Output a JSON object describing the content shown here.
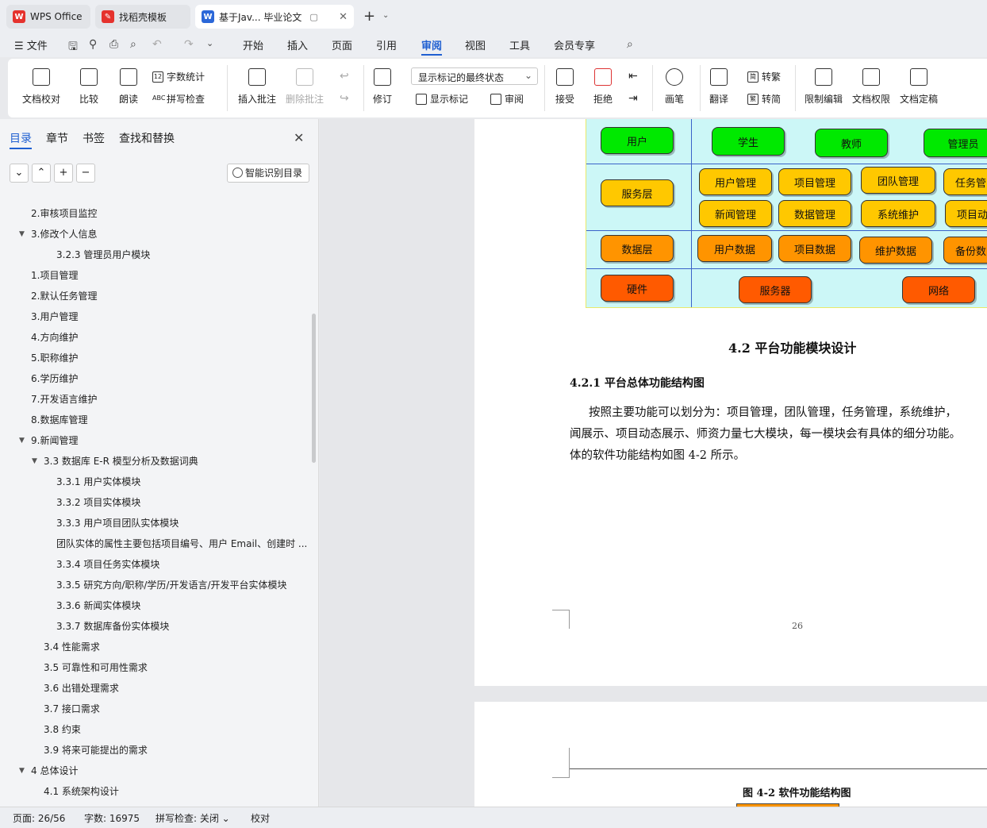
{
  "tabs": [
    {
      "label": "WPS Office",
      "icon": "wps-logo-icon"
    },
    {
      "label": "找稻壳模板",
      "icon": "docer-icon"
    },
    {
      "label": "基于Jav... 毕业论文",
      "icon": "writer-doc-icon"
    }
  ],
  "menu": {
    "file": "文件",
    "items": [
      "开始",
      "插入",
      "页面",
      "引用",
      "审阅",
      "视图",
      "工具",
      "会员专享"
    ],
    "active": "审阅"
  },
  "ribbon": {
    "doc_proof": "文档校对",
    "compare": "比较",
    "read_aloud": "朗读",
    "word_count": "字数统计",
    "spell_check": "拼写检查",
    "insert_comment": "插入批注",
    "delete_comment": "删除批注",
    "track_changes": "修订",
    "markup_state": "显示标记的最终状态",
    "show_markup": "显示标记",
    "review": "审阅",
    "accept": "接受",
    "reject": "拒绝",
    "pen": "画笔",
    "translate": "翻译",
    "to_traditional": "转繁",
    "to_simplified": "转简",
    "restrict_edit": "限制编辑",
    "doc_permission": "文档权限",
    "doc_finalize": "文档定稿"
  },
  "sidebar": {
    "tabs": [
      "目录",
      "章节",
      "书签",
      "查找和替换"
    ],
    "smart_toc": "智能识别目录",
    "toc": [
      {
        "text": "2.审核项目监控",
        "level": 1
      },
      {
        "text": "3.修改个人信息",
        "level": 1,
        "expanded": true
      },
      {
        "text": "3.2.3  管理员用户模块",
        "level": 3
      },
      {
        "text": "1.项目管理",
        "level": 1
      },
      {
        "text": "2.默认任务管理",
        "level": 1
      },
      {
        "text": "3.用户管理",
        "level": 1
      },
      {
        "text": "4.方向维护",
        "level": 1
      },
      {
        "text": "5.职称维护",
        "level": 1
      },
      {
        "text": "6.学历维护",
        "level": 1
      },
      {
        "text": "7.开发语言维护",
        "level": 1
      },
      {
        "text": "8.数据库管理",
        "level": 1
      },
      {
        "text": "9.新闻管理",
        "level": 1,
        "expanded": true
      },
      {
        "text": "3.3 数据库 E-R 模型分析及数据词典",
        "level": 2,
        "expanded": true
      },
      {
        "text": "3.3.1  用户实体模块",
        "level": 3
      },
      {
        "text": "3.3.2  项目实体模块",
        "level": 3
      },
      {
        "text": "3.3.3  用户项目团队实体模块",
        "level": 3
      },
      {
        "text": "团队实体的属性主要包括项目编号、用户 Email、创建时 ...",
        "level": 3
      },
      {
        "text": "3.3.4  项目任务实体模块",
        "level": 3
      },
      {
        "text": "3.3.5  研究方向/职称/学历/开发语言/开发平台实体模块",
        "level": 3
      },
      {
        "text": "3.3.6  新闻实体模块",
        "level": 3
      },
      {
        "text": "3.3.7  数据库备份实体模块",
        "level": 3
      },
      {
        "text": "3.4  性能需求",
        "level": 2
      },
      {
        "text": "3.5  可靠性和可用性需求",
        "level": 2
      },
      {
        "text": "3.6  出错处理需求",
        "level": 2
      },
      {
        "text": "3.7  接口需求",
        "level": 2
      },
      {
        "text": "3.8  约束",
        "level": 2
      },
      {
        "text": "3.9  将来可能提出的需求",
        "level": 2
      },
      {
        "text": "4  总体设计",
        "level": 1,
        "expanded": true
      },
      {
        "text": "4.1  系统架构设计",
        "level": 2
      }
    ]
  },
  "document": {
    "diagram": {
      "row_labels": [
        "用户",
        "服务层",
        "数据层",
        "硬件"
      ],
      "users": [
        "学生",
        "教师",
        "管理员"
      ],
      "services_row1": [
        "用户管理",
        "项目管理",
        "团队管理",
        "任务管"
      ],
      "services_row2": [
        "新闻管理",
        "数据管理",
        "系统维护",
        "项目动"
      ],
      "data": [
        "用户数据",
        "项目数据",
        "维护数据",
        "备份数"
      ],
      "hardware": [
        "服务器",
        "网络"
      ]
    },
    "section_title": "4.2  平台功能模块设计",
    "subsection_title": "4.2.1  平台总体功能结构图",
    "paragraph_lines": [
      "按照主要功能可以划分为：项目管理，团队管理，任务管理，系统维护，",
      "闻展示、项目动态展示、师资力量七大模块，每一模块会有具体的细分功能。",
      "体的软件功能结构如图 4-2 所示。"
    ],
    "page_number": "26",
    "figure_caption": "图 4-2 软件功能结构图"
  },
  "status": {
    "page": "页面: 26/56",
    "words": "字数: 16975",
    "spell": "拼写检查: 关闭",
    "proof": "校对"
  },
  "colors": {
    "accent": "#1f5fd1",
    "green": "#00e900",
    "yellow": "#ffc800",
    "orange": "#ff9400",
    "red": "#ff5a00",
    "diagram_bg": "#ccf7f7"
  }
}
